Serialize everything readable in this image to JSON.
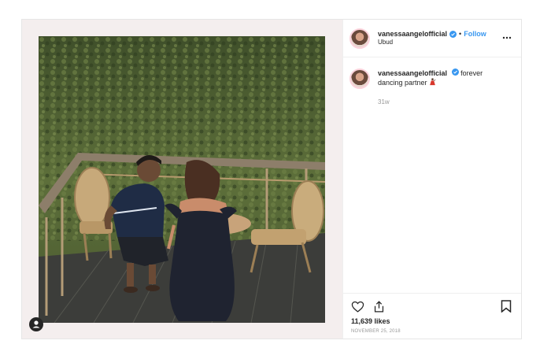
{
  "post": {
    "username": "vanessaangelofficial",
    "follow_label": "Follow",
    "separator": "•",
    "location": "Ubud",
    "caption_text": "forever dancing partner",
    "caption_emoji": "dancer-emoji",
    "time_ago": "31w",
    "likes": "11,639 likes",
    "date": "NOVEMBER 25, 2018"
  },
  "icons": {
    "verified": "verified-badge-icon",
    "more": "more-options-icon",
    "heart": "heart-icon",
    "share": "share-icon",
    "bookmark": "bookmark-icon",
    "user_tag": "user-tag-icon"
  },
  "colors": {
    "link": "#3897f0",
    "text": "#262626",
    "muted": "#999999",
    "border": "#efefef",
    "frame": "#f4eeee"
  }
}
